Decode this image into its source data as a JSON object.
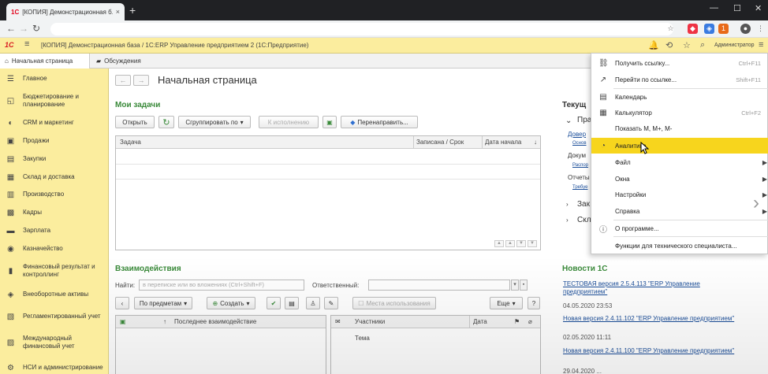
{
  "browser": {
    "tab_title": "[КОПИЯ] Демонстрационная б...",
    "tab_close": "×",
    "new_tab": "+",
    "win_min": "—",
    "win_max": "☐",
    "win_close": "✕"
  },
  "app": {
    "logo": "1С",
    "title": "[КОПИЯ] Демонстрационная база / 1С:ERP Управление предприятием 2  (1С:Предприятие)",
    "user": "Администратор"
  },
  "section_tabs": [
    {
      "label": "Начальная страница"
    },
    {
      "label": "Обсуждения"
    }
  ],
  "sidebar": {
    "items": [
      {
        "label": "Главное",
        "icon": "☰"
      },
      {
        "label": "Бюджетирование и планирование",
        "icon": "◱"
      },
      {
        "label": "CRM и маркетинг",
        "icon": "◐"
      },
      {
        "label": "Продажи",
        "icon": "▣"
      },
      {
        "label": "Закупки",
        "icon": "▤"
      },
      {
        "label": "Склад и доставка",
        "icon": "▦"
      },
      {
        "label": "Производство",
        "icon": "▥"
      },
      {
        "label": "Кадры",
        "icon": "▩"
      },
      {
        "label": "Зарплата",
        "icon": "▬"
      },
      {
        "label": "Казначейство",
        "icon": "◉"
      },
      {
        "label": "Финансовый результат и контроллинг",
        "icon": "▮"
      },
      {
        "label": "Внеоборотные активы",
        "icon": "◈"
      },
      {
        "label": "Регламентированный учет",
        "icon": "▧"
      },
      {
        "label": "Международный финансовый учет",
        "icon": "▨"
      },
      {
        "label": "НСИ и администрирование",
        "icon": "⚙"
      }
    ]
  },
  "page": {
    "title": "Начальная страница"
  },
  "tasks": {
    "header": "Мои задачи",
    "open_btn": "Открыть",
    "group_btn": "Сгруппировать по",
    "exec_btn": "К исполнению",
    "redirect_btn": "Перенаправить...",
    "columns": [
      "Задача",
      "Записана / Срок",
      "Дата начала"
    ]
  },
  "interactions": {
    "header": "Взаимодействия",
    "find_label": "Найти:",
    "find_placeholder": "в переписке или во вложениях (Ctrl+Shift+F)",
    "responsible_label": "Ответственный:",
    "by_subject_btn": "По предметам",
    "create_btn": "Создать",
    "places_btn": "Места использования",
    "more_btn": "Еще",
    "help_btn": "?",
    "left_col": "Последнее взаимодействие",
    "right_cols": [
      "Участники",
      "Дата"
    ],
    "right_sub": "Тема"
  },
  "right_panel": {
    "current_header": "Текущ",
    "group1": "Пра",
    "row1": "Довер",
    "row1_sub": "Основ",
    "row2": "Докум",
    "row2_sub": "Распор",
    "row3": "Отчеты",
    "row3_sub": "Требуе",
    "group2": "Зак",
    "group3": "Скл",
    "news_header": "Новости 1С",
    "news": [
      {
        "title": "ТЕСТОВАЯ версия 2.5.4.113 \"ERP Управление предприятием\"",
        "date": "04.05.2020 23:53"
      },
      {
        "title": "Новая версия 2.4.11.102 \"ERP Управление предприятием\"",
        "date": "02.05.2020 11:11"
      },
      {
        "title": "Новая версия 2.4.11.100 \"ERP Управление предприятием\"",
        "date": "29.04.2020 ..."
      }
    ]
  },
  "context_menu": {
    "items": [
      {
        "label": "Получить ссылку...",
        "shortcut": "Ctrl+F11",
        "icon": "🔗"
      },
      {
        "label": "Перейти по ссылке...",
        "shortcut": "Shift+F11",
        "icon": "↗"
      },
      {
        "label": "Калькулятор",
        "shortcut": "Ctrl+F2",
        "icon": "▦"
      },
      {
        "label": "Календарь",
        "shortcut": "",
        "icon": "▤"
      },
      {
        "label": "Показать M, M+, M-",
        "shortcut": "",
        "icon": ""
      },
      {
        "label": "Аналитика",
        "shortcut": "",
        "icon": "◔"
      },
      {
        "label": "Файл",
        "shortcut": "",
        "icon": ""
      },
      {
        "label": "Окна",
        "shortcut": "",
        "icon": ""
      },
      {
        "label": "Настройки",
        "shortcut": "",
        "icon": ""
      },
      {
        "label": "Справка",
        "shortcut": "",
        "icon": ""
      },
      {
        "label": "О программе...",
        "shortcut": "",
        "icon": "ⓘ"
      },
      {
        "label": "Функции для технического специалиста...",
        "shortcut": "",
        "icon": ""
      }
    ]
  },
  "colors": {
    "accent_yellow": "#fbed9e",
    "highlight": "#f7d51d",
    "section_green": "#3a8a3a",
    "link_blue": "#1a4d99"
  }
}
